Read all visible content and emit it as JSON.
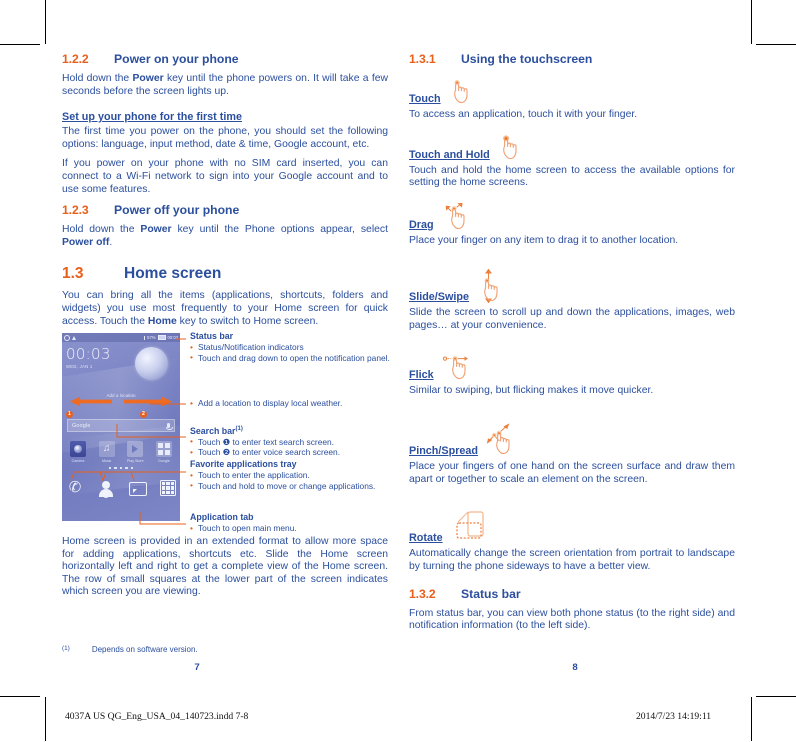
{
  "colors": {
    "blue": "#2b4f9e",
    "orange": "#e8601c",
    "phone_bg": "#7b84c4"
  },
  "left_column": {
    "sec_122": {
      "number": "1.2.2",
      "title": "Power on your phone",
      "p1_a": "Hold down the ",
      "p1_b": "Power",
      "p1_c": " key until the phone powers on. It will take a few seconds before the screen lights up.",
      "sub1": "Set up your phone for the first time",
      "p2": "The first time you power on the phone, you should set the following options: language, input method, date & time, Google account, etc.",
      "p3": "If you power on your phone with no SIM card inserted, you can connect to a Wi-Fi network to sign into your Google account and to use some features."
    },
    "sec_123": {
      "number": "1.2.3",
      "title": "Power off your phone",
      "p1_a": "Hold down the ",
      "p1_b": "Power",
      "p1_c": " key until the Phone options appear, select ",
      "p1_d": "Power off",
      "p1_e": "."
    },
    "sec_13": {
      "number": "1.3",
      "title": "Home screen",
      "p1_a": "You can bring all the items (applications, shortcuts, folders and widgets) you use most frequently to your Home screen for quick access. Touch the ",
      "p1_b": "Home",
      "p1_c": " key to switch to Home screen.",
      "p2": "Home screen is provided in an extended format to allow more space for adding applications, shortcuts etc. Slide the Home screen horizontally left and right to get a complete view of the Home screen. The row of small squares at the lower part of the screen indicates which screen you are viewing."
    },
    "annotations": [
      {
        "title": "Status bar",
        "items": [
          "Status/Notification indicators",
          "Touch and drag down to open the notification panel."
        ]
      },
      {
        "title": "",
        "items": [
          "Add a location to display local weather."
        ]
      },
      {
        "title": "Search bar",
        "title_sup": "(1)",
        "items": [
          "Touch ❶ to enter text search screen.",
          "Touch ❷ to enter voice search screen."
        ]
      },
      {
        "title": "Favorite applications tray",
        "items": [
          "Touch to enter the application.",
          "Touch and hold to move or change applications."
        ]
      },
      {
        "title": "Application tab",
        "items": [
          "Touch to open main menu."
        ]
      }
    ],
    "footnote": {
      "marker": "(1)",
      "text": "Depends on software version."
    }
  },
  "phone_mockup": {
    "status_bar": {
      "battery": "57%",
      "time": "00:03"
    },
    "clock_widget": {
      "time": "00:03",
      "date": "WED, JAN 1",
      "add_location": "Add a location"
    },
    "search_bar": {
      "text": "Google",
      "badge_1": "1",
      "badge_2": "2"
    },
    "apps": [
      {
        "name": "Camera",
        "icon": "camera-icon"
      },
      {
        "name": "Music",
        "icon": "music-icon"
      },
      {
        "name": "Play Store",
        "icon": "play-store-icon"
      },
      {
        "name": "Google",
        "icon": "google-folder-icon"
      }
    ],
    "dock": [
      {
        "icon": "phone-icon"
      },
      {
        "icon": "contacts-icon"
      },
      {
        "icon": "messaging-icon"
      },
      {
        "icon": "app-drawer-icon"
      }
    ],
    "page_dots": 5
  },
  "right_column": {
    "sec_131": {
      "number": "1.3.1",
      "title": "Using the touchscreen"
    },
    "gestures": [
      {
        "label": "Touch",
        "icon": "touch-hand-icon",
        "text": "To access an application, touch it with your finger."
      },
      {
        "label": "Touch and Hold",
        "icon": "touch-hold-hand-icon",
        "text": "Touch and hold the home screen to access the available options for setting the home screens."
      },
      {
        "label": "Drag",
        "icon": "drag-hand-icon",
        "text": "Place your finger on any item to drag it to another location."
      },
      {
        "label": "Slide/Swipe",
        "icon": "slide-hand-icon",
        "text": "Slide the screen to scroll up and down the applications, images, web pages… at your convenience."
      },
      {
        "label": "Flick",
        "icon": "flick-hand-icon",
        "text": "Similar to swiping, but flicking makes it move quicker."
      },
      {
        "label": "Pinch/Spread",
        "icon": "pinch-spread-hand-icon",
        "text": "Place your fingers of one hand on the screen surface and draw them apart or together to scale an element on the screen."
      },
      {
        "label": "Rotate",
        "icon": "rotate-device-icon",
        "text": "Automatically change the screen orientation from portrait to landscape by turning the phone sideways to have a better view."
      }
    ],
    "sec_132": {
      "number": "1.3.2",
      "title": "Status bar",
      "p1": "From status bar, you can view both phone status (to the right side) and notification information (to the left side)."
    }
  },
  "folio": {
    "left": "7",
    "right": "8"
  },
  "print_line": {
    "left": "4037A US QG_Eng_USA_04_140723.indd  7-8",
    "right": "2014/7/23   14:19:11"
  }
}
